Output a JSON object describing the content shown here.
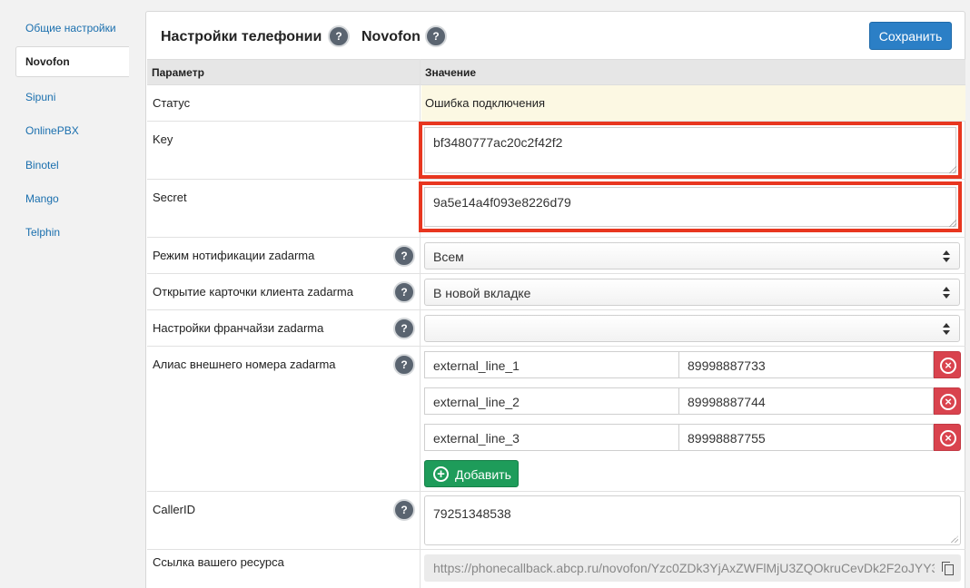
{
  "sidebar": {
    "items": [
      {
        "label": "Общие настройки"
      },
      {
        "label": "Novofon"
      },
      {
        "label": "Sipuni"
      },
      {
        "label": "OnlinePBX"
      },
      {
        "label": "Binotel"
      },
      {
        "label": "Mango"
      },
      {
        "label": "Telphin"
      }
    ],
    "active": "Novofon"
  },
  "header": {
    "title": "Настройки телефонии",
    "provider": "Novofon",
    "help_glyph": "?",
    "save_label": "Сохранить"
  },
  "table": {
    "col_param": "Параметр",
    "col_value": "Значение"
  },
  "rows": {
    "status": {
      "label": "Статус",
      "value": "Ошибка подключения"
    },
    "key": {
      "label": "Key",
      "value": "bf3480777ac20c2f42f2"
    },
    "secret": {
      "label": "Secret",
      "value": "9a5e14a4f093e8226d79"
    },
    "notify_mode": {
      "label": "Режим нотификации zadarma",
      "value": "Всем"
    },
    "card_open": {
      "label": "Открытие карточки клиента zadarma",
      "value": "В новой вкладке"
    },
    "franchise": {
      "label": "Настройки франчайзи zadarma",
      "value": ""
    },
    "alias": {
      "label": "Алиас внешнего номера zadarma",
      "lines": [
        {
          "name": "external_line_1",
          "number": "89998887733"
        },
        {
          "name": "external_line_2",
          "number": "89998887744"
        },
        {
          "name": "external_line_3",
          "number": "89998887755"
        }
      ],
      "add_label": "Добавить"
    },
    "callerid": {
      "label": "CallerID",
      "value": "79251348538"
    },
    "resource_link": {
      "label": "Ссылка вашего ресурса",
      "value": "https://phonecallback.abcp.ru/novofon/Yzc0ZDk3YjAxZWFlMjU3ZQOkruCevDk2F2oJYY3"
    }
  },
  "colors": {
    "accent": "#2b7fc6",
    "status_bg": "#fcf8e3",
    "highlight_border": "#e8361f",
    "danger": "#d9434e",
    "success": "#1e9c5a",
    "link": "#1a6fae"
  }
}
